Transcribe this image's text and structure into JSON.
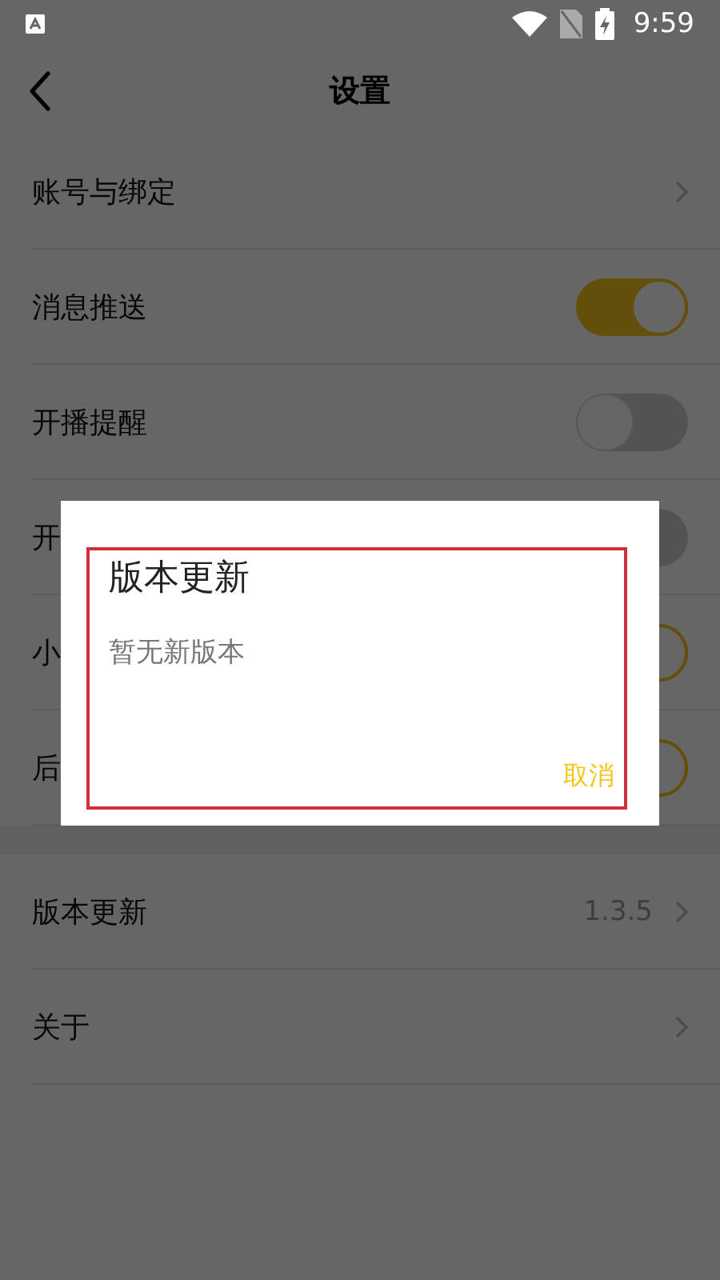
{
  "status_bar": {
    "time": "9:59"
  },
  "header": {
    "title": "设置"
  },
  "sections": [
    {
      "rows": [
        {
          "kind": "link",
          "label": "账号与绑定"
        },
        {
          "kind": "toggle",
          "label": "消息推送",
          "on": true
        },
        {
          "kind": "toggle",
          "label": "开播提醒",
          "on": false
        },
        {
          "kind": "toggle",
          "label": "开",
          "on": false
        },
        {
          "kind": "toggle",
          "label": "小",
          "on": true
        },
        {
          "kind": "toggle",
          "label": "后",
          "on": true
        }
      ]
    },
    {
      "rows": [
        {
          "kind": "link",
          "label": "版本更新",
          "value": "1.3.5"
        },
        {
          "kind": "link",
          "label": "关于"
        }
      ]
    }
  ],
  "dialog": {
    "title": "版本更新",
    "message": "暂无新版本",
    "buttons": [
      "取消"
    ]
  }
}
